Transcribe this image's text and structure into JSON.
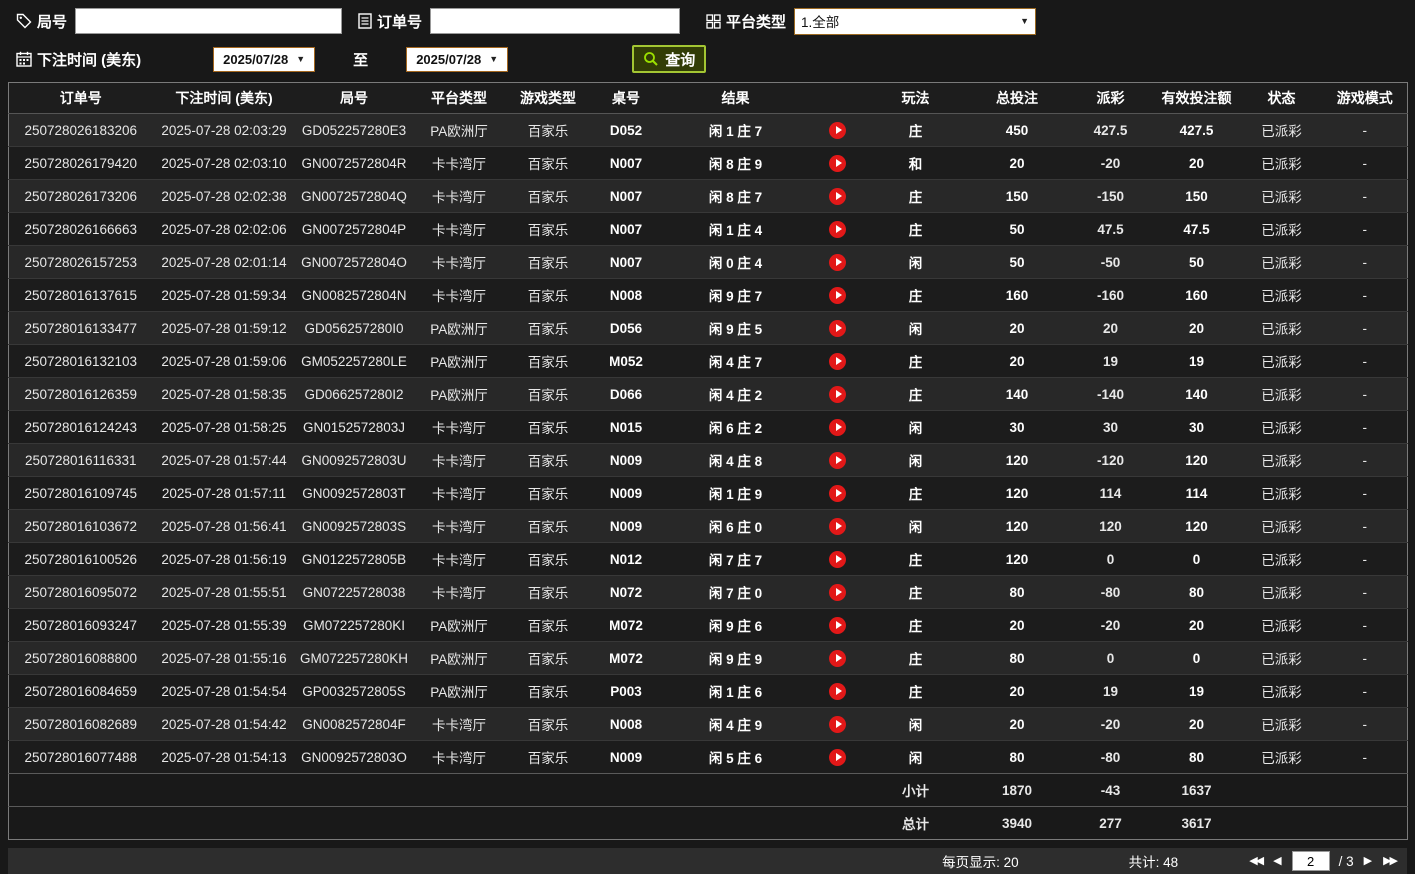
{
  "filters": {
    "round_label": "局号",
    "order_label": "订单号",
    "platform_label": "平台类型",
    "platform_value": "1.全部",
    "bet_time_label": "下注时间 (美东)",
    "to_label": "至",
    "date_from": "2025/07/28",
    "date_to": "2025/07/28",
    "query_label": "查询"
  },
  "icons": {
    "dropdown_caret": "▼",
    "first_page": "◀◀",
    "prev_page": "◀",
    "next_page": "▶",
    "last_page": "▶▶"
  },
  "colors": {
    "payout_positive": "#a81414",
    "payout_negative": "#00cc22",
    "status_paid": "#00bb22",
    "summary_text": "#ffee00",
    "accent_green": "#a3c633",
    "play_button_red": "#e21818"
  },
  "table": {
    "headers": [
      "订单号",
      "下注时间 (美东)",
      "局号",
      "平台类型",
      "游戏类型",
      "桌号",
      "结果",
      "",
      "玩法",
      "总投注",
      "派彩",
      "有效投注额",
      "状态",
      "游戏模式"
    ],
    "rows": [
      {
        "id": "250728026183206",
        "time": "2025-07-28 02:03:29",
        "round": "GD052257280E3",
        "platform": "PA欧洲厅",
        "game": "百家乐",
        "table": "D052",
        "result": "闲 1 庄 7",
        "play": "庄",
        "bet": "450",
        "payout": "427.5",
        "pay": "pos",
        "valid": "427.5",
        "status": "已派彩",
        "mode": "-"
      },
      {
        "id": "250728026179420",
        "time": "2025-07-28 02:03:10",
        "round": "GN0072572804R",
        "platform": "卡卡湾厅",
        "game": "百家乐",
        "table": "N007",
        "result": "闲 8 庄 9",
        "play": "和",
        "bet": "20",
        "payout": "-20",
        "pay": "neg",
        "valid": "20",
        "status": "已派彩",
        "mode": "-"
      },
      {
        "id": "250728026173206",
        "time": "2025-07-28 02:02:38",
        "round": "GN0072572804Q",
        "platform": "卡卡湾厅",
        "game": "百家乐",
        "table": "N007",
        "result": "闲 8 庄 7",
        "play": "庄",
        "bet": "150",
        "payout": "-150",
        "pay": "neg",
        "valid": "150",
        "status": "已派彩",
        "mode": "-"
      },
      {
        "id": "250728026166663",
        "time": "2025-07-28 02:02:06",
        "round": "GN0072572804P",
        "platform": "卡卡湾厅",
        "game": "百家乐",
        "table": "N007",
        "result": "闲 1 庄 4",
        "play": "庄",
        "bet": "50",
        "payout": "47.5",
        "pay": "pos",
        "valid": "47.5",
        "status": "已派彩",
        "mode": "-"
      },
      {
        "id": "250728026157253",
        "time": "2025-07-28 02:01:14",
        "round": "GN0072572804O",
        "platform": "卡卡湾厅",
        "game": "百家乐",
        "table": "N007",
        "result": "闲 0 庄 4",
        "play": "闲",
        "bet": "50",
        "payout": "-50",
        "pay": "neg",
        "valid": "50",
        "status": "已派彩",
        "mode": "-"
      },
      {
        "id": "250728016137615",
        "time": "2025-07-28 01:59:34",
        "round": "GN0082572804N",
        "platform": "卡卡湾厅",
        "game": "百家乐",
        "table": "N008",
        "result": "闲 9 庄 7",
        "play": "庄",
        "bet": "160",
        "payout": "-160",
        "pay": "neg",
        "valid": "160",
        "status": "已派彩",
        "mode": "-"
      },
      {
        "id": "250728016133477",
        "time": "2025-07-28 01:59:12",
        "round": "GD056257280I0",
        "platform": "PA欧洲厅",
        "game": "百家乐",
        "table": "D056",
        "result": "闲 9 庄 5",
        "play": "闲",
        "bet": "20",
        "payout": "20",
        "pay": "pos",
        "valid": "20",
        "status": "已派彩",
        "mode": "-"
      },
      {
        "id": "250728016132103",
        "time": "2025-07-28 01:59:06",
        "round": "GM052257280LE",
        "platform": "PA欧洲厅",
        "game": "百家乐",
        "table": "M052",
        "result": "闲 4 庄 7",
        "play": "庄",
        "bet": "20",
        "payout": "19",
        "pay": "pos",
        "valid": "19",
        "status": "已派彩",
        "mode": "-"
      },
      {
        "id": "250728016126359",
        "time": "2025-07-28 01:58:35",
        "round": "GD066257280I2",
        "platform": "PA欧洲厅",
        "game": "百家乐",
        "table": "D066",
        "result": "闲 4 庄 2",
        "play": "庄",
        "bet": "140",
        "payout": "-140",
        "pay": "neg",
        "valid": "140",
        "status": "已派彩",
        "mode": "-"
      },
      {
        "id": "250728016124243",
        "time": "2025-07-28 01:58:25",
        "round": "GN0152572803J",
        "platform": "卡卡湾厅",
        "game": "百家乐",
        "table": "N015",
        "result": "闲 6 庄 2",
        "play": "闲",
        "bet": "30",
        "payout": "30",
        "pay": "pos",
        "valid": "30",
        "status": "已派彩",
        "mode": "-"
      },
      {
        "id": "250728016116331",
        "time": "2025-07-28 01:57:44",
        "round": "GN0092572803U",
        "platform": "卡卡湾厅",
        "game": "百家乐",
        "table": "N009",
        "result": "闲 4 庄 8",
        "play": "闲",
        "bet": "120",
        "payout": "-120",
        "pay": "neg",
        "valid": "120",
        "status": "已派彩",
        "mode": "-"
      },
      {
        "id": "250728016109745",
        "time": "2025-07-28 01:57:11",
        "round": "GN0092572803T",
        "platform": "卡卡湾厅",
        "game": "百家乐",
        "table": "N009",
        "result": "闲 1 庄 9",
        "play": "庄",
        "bet": "120",
        "payout": "114",
        "pay": "pos",
        "valid": "114",
        "status": "已派彩",
        "mode": "-"
      },
      {
        "id": "250728016103672",
        "time": "2025-07-28 01:56:41",
        "round": "GN0092572803S",
        "platform": "卡卡湾厅",
        "game": "百家乐",
        "table": "N009",
        "result": "闲 6 庄 0",
        "play": "闲",
        "bet": "120",
        "payout": "120",
        "pay": "pos",
        "valid": "120",
        "status": "已派彩",
        "mode": "-"
      },
      {
        "id": "250728016100526",
        "time": "2025-07-28 01:56:19",
        "round": "GN0122572805B",
        "platform": "卡卡湾厅",
        "game": "百家乐",
        "table": "N012",
        "result": "闲 7 庄 7",
        "play": "庄",
        "bet": "120",
        "payout": "0",
        "pay": "zero",
        "valid": "0",
        "status": "已派彩",
        "mode": "-"
      },
      {
        "id": "250728016095072",
        "time": "2025-07-28 01:55:51",
        "round": "GN07225728038",
        "platform": "卡卡湾厅",
        "game": "百家乐",
        "table": "N072",
        "result": "闲 7 庄 0",
        "play": "庄",
        "bet": "80",
        "payout": "-80",
        "pay": "neg",
        "valid": "80",
        "status": "已派彩",
        "mode": "-"
      },
      {
        "id": "250728016093247",
        "time": "2025-07-28 01:55:39",
        "round": "GM072257280KI",
        "platform": "PA欧洲厅",
        "game": "百家乐",
        "table": "M072",
        "result": "闲 9 庄 6",
        "play": "庄",
        "bet": "20",
        "payout": "-20",
        "pay": "neg",
        "valid": "20",
        "status": "已派彩",
        "mode": "-"
      },
      {
        "id": "250728016088800",
        "time": "2025-07-28 01:55:16",
        "round": "GM072257280KH",
        "platform": "PA欧洲厅",
        "game": "百家乐",
        "table": "M072",
        "result": "闲 9 庄 9",
        "play": "庄",
        "bet": "80",
        "payout": "0",
        "pay": "zero",
        "valid": "0",
        "status": "已派彩",
        "mode": "-"
      },
      {
        "id": "250728016084659",
        "time": "2025-07-28 01:54:54",
        "round": "GP0032572805S",
        "platform": "PA欧洲厅",
        "game": "百家乐",
        "table": "P003",
        "result": "闲 1 庄 6",
        "play": "庄",
        "bet": "20",
        "payout": "19",
        "pay": "pos",
        "valid": "19",
        "status": "已派彩",
        "mode": "-"
      },
      {
        "id": "250728016082689",
        "time": "2025-07-28 01:54:42",
        "round": "GN0082572804F",
        "platform": "卡卡湾厅",
        "game": "百家乐",
        "table": "N008",
        "result": "闲 4 庄 9",
        "play": "闲",
        "bet": "20",
        "payout": "-20",
        "pay": "neg",
        "valid": "20",
        "status": "已派彩",
        "mode": "-"
      },
      {
        "id": "250728016077488",
        "time": "2025-07-28 01:54:13",
        "round": "GN0092572803O",
        "platform": "卡卡湾厅",
        "game": "百家乐",
        "table": "N009",
        "result": "闲 5 庄 6",
        "play": "闲",
        "bet": "80",
        "payout": "-80",
        "pay": "neg",
        "valid": "80",
        "status": "已派彩",
        "mode": "-"
      }
    ]
  },
  "summary": {
    "subtotal_label": "小计",
    "subtotal": [
      "1870",
      "-43",
      "1637"
    ],
    "total_label": "总计",
    "total": [
      "3940",
      "277",
      "3617"
    ]
  },
  "footer": {
    "per_page": "每页显示: 20",
    "total_count": "共计: 48",
    "current_page": "2",
    "page_total": "/ 3"
  }
}
